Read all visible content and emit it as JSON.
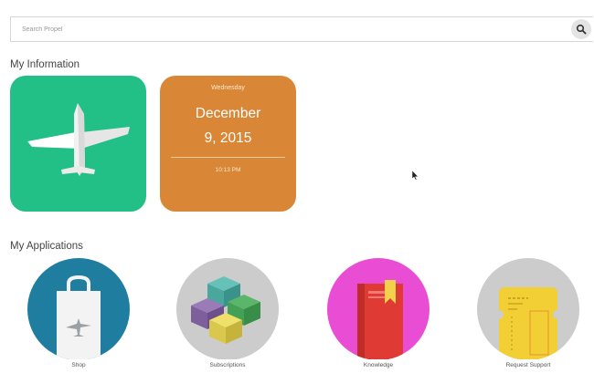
{
  "search": {
    "placeholder": "Search Propel",
    "icon": "search-icon"
  },
  "my_information": {
    "title": "My Information",
    "travel_tile": {
      "icon": "airplane-icon",
      "color": "#22bf86"
    },
    "date_tile": {
      "weekday": "Wednesday",
      "month": "December",
      "day_year": "9, 2015",
      "time": "10:13 PM",
      "color": "#d98736"
    }
  },
  "my_applications": {
    "title": "My Applications",
    "apps": [
      {
        "label": "Shop",
        "icon": "shopping-bag-icon",
        "color": "#1f7ea0"
      },
      {
        "label": "Subscriptions",
        "icon": "cubes-icon",
        "color": "#cccccc"
      },
      {
        "label": "Knowledge",
        "icon": "book-icon",
        "color": "#e94dd4"
      },
      {
        "label": "Request Support",
        "icon": "ticket-icon",
        "color": "#cccccc"
      }
    ]
  }
}
